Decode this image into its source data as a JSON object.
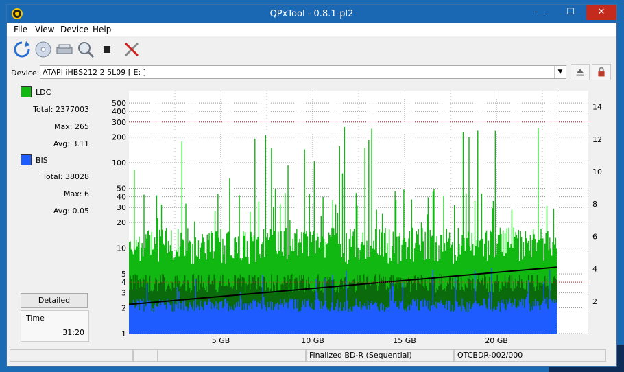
{
  "window": {
    "title": "QPxTool - 0.8.1-pl2"
  },
  "controls": {
    "minimize": "—",
    "maximize": "☐",
    "close": "✕"
  },
  "menu": [
    "File",
    "View",
    "Device",
    "Help"
  ],
  "device": {
    "label": "Device:",
    "value": "ATAPI   iHBS212   2     5L09 [ E: ]"
  },
  "stats": {
    "ldc": {
      "name": "LDC",
      "color": "#12b812",
      "total": "Total: 2377003",
      "max": "Max: 265",
      "avg": "Avg: 3.11"
    },
    "bis": {
      "name": "BIS",
      "color": "#1e5cff",
      "total": "Total: 38028",
      "max": "Max: 6",
      "avg": "Avg: 0.05"
    }
  },
  "detailed_label": "Detailed",
  "time": {
    "label": "Time",
    "value": "31:20"
  },
  "status": {
    "disc": "Finalized BD-R (Sequential)",
    "media": "OTCBDR-002/000"
  },
  "chart_data": {
    "type": "area",
    "left_axis": {
      "scale": "log",
      "range": [
        1,
        700
      ],
      "ticks": [
        1,
        2,
        3,
        4,
        5,
        10,
        20,
        30,
        40,
        50,
        100,
        200,
        300,
        400,
        500
      ]
    },
    "right_axis": {
      "range": [
        0,
        15
      ],
      "ticks": [
        2,
        4,
        6,
        8,
        10,
        12,
        14
      ]
    },
    "x_axis": {
      "unit": "GB",
      "range": [
        0,
        25
      ],
      "ticks": [
        "5 GB",
        "10 GB",
        "15 GB",
        "20 GB"
      ],
      "tick_values": [
        5,
        10,
        15,
        20
      ]
    },
    "data_end_gb": 23.3,
    "series": [
      {
        "name": "LDC",
        "color": "#12b812",
        "typical": 12,
        "peak": 265
      },
      {
        "name": "BIS",
        "color": "#1e5cff",
        "typical": 2,
        "peak": 6
      },
      {
        "name": "speed",
        "color": "#000000",
        "x": [
          0,
          23.3
        ],
        "y": [
          1.8,
          4.1
        ]
      }
    ]
  }
}
